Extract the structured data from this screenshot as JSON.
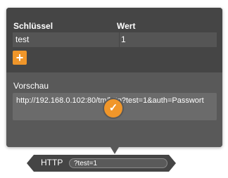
{
  "params": {
    "key_header": "Schlüssel",
    "value_header": "Wert",
    "rows": [
      {
        "key": "test",
        "value": "1"
      }
    ],
    "add_icon": "plus-icon"
  },
  "preview": {
    "label": "Vorschau",
    "url": "http://192.168.0.102:80/tm/http?test=1&auth=Passwort"
  },
  "confirm_icon": "checkmark-icon",
  "bar": {
    "label": "HTTP",
    "value": "?test=1"
  },
  "colors": {
    "accent": "#f0962a",
    "panel": "#454545"
  }
}
